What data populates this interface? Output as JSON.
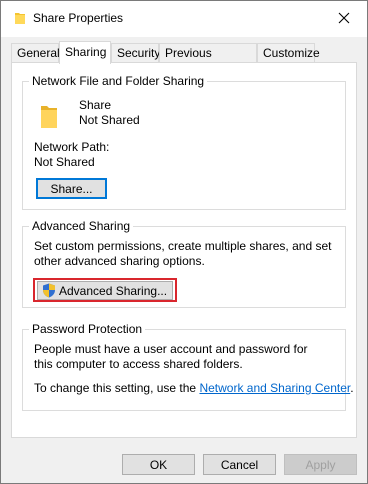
{
  "window": {
    "title": "Share Properties"
  },
  "tabs": [
    {
      "label": "General"
    },
    {
      "label": "Sharing"
    },
    {
      "label": "Security"
    },
    {
      "label": "Previous Versions"
    },
    {
      "label": "Customize"
    }
  ],
  "network_sharing": {
    "group_label": "Network File and Folder Sharing",
    "folder_name": "Share",
    "folder_status": "Not Shared",
    "path_label": "Network Path:",
    "path_value": "Not Shared",
    "share_button": "Share..."
  },
  "advanced_sharing": {
    "group_label": "Advanced Sharing",
    "description": "Set custom permissions, create multiple shares, and set other advanced sharing options.",
    "button": "Advanced Sharing..."
  },
  "password_protection": {
    "group_label": "Password Protection",
    "description": "People must have a user account and password for this computer to access shared folders.",
    "change_prefix": "To change this setting, use the ",
    "link": "Network and Sharing Center",
    "change_suffix": "."
  },
  "footer": {
    "ok": "OK",
    "cancel": "Cancel",
    "apply": "Apply"
  },
  "colors": {
    "highlight": "#d9262d",
    "link": "#0066cc",
    "focus": "#0078d7",
    "folder": "#f4c430"
  },
  "icons": {
    "title": "folder-icon",
    "close": "close-icon",
    "folder": "folder-icon",
    "shield": "uac-shield-icon"
  }
}
